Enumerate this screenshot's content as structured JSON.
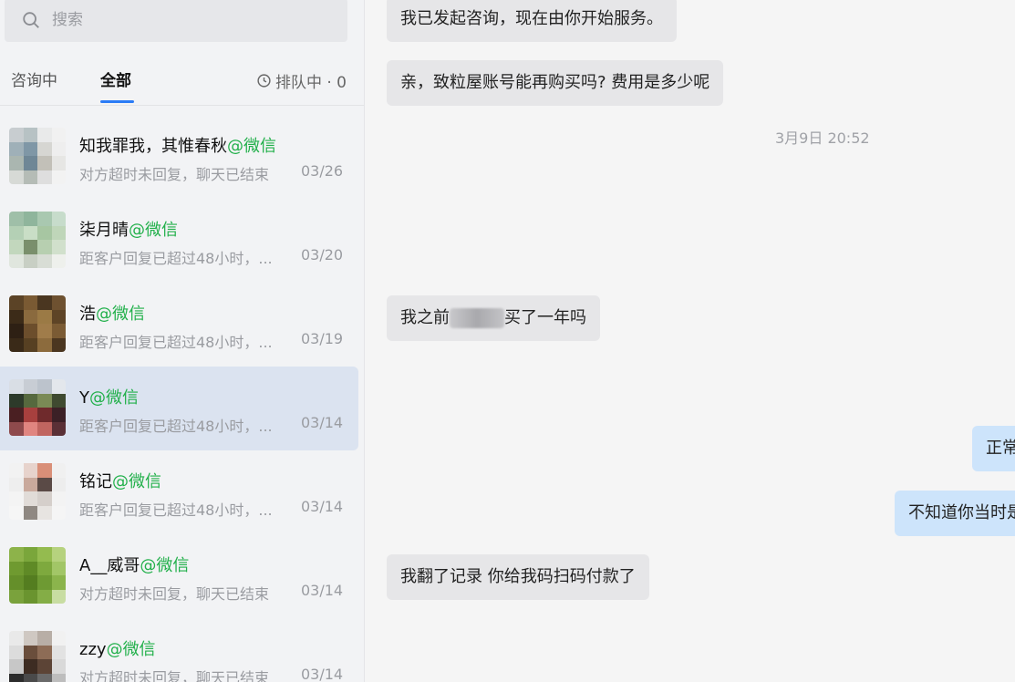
{
  "search": {
    "placeholder": "搜索"
  },
  "tabs": [
    {
      "label": "咨询中"
    },
    {
      "label": "全部"
    }
  ],
  "queue": {
    "label": "排队中 · 0"
  },
  "conversations": [
    {
      "name": "知我罪我，其惟春秋",
      "source": "@微信",
      "preview": "对方超时未回复，聊天已结束",
      "date": "03/26"
    },
    {
      "name": "柒月晴",
      "source": "@微信",
      "preview": "距客户回复已超过48小时，...",
      "date": "03/20"
    },
    {
      "name": "浩",
      "source": "@微信",
      "preview": "距客户回复已超过48小时，...",
      "date": "03/19"
    },
    {
      "name": "Y",
      "source": "@微信",
      "preview": "距客户回复已超过48小时，...",
      "date": "03/14"
    },
    {
      "name": "铭记",
      "source": "@微信",
      "preview": "距客户回复已超过48小时，...",
      "date": "03/14"
    },
    {
      "name": "A__威哥",
      "source": "@微信",
      "preview": "对方超时未回复，聊天已结束",
      "date": "03/14"
    },
    {
      "name": "zzy",
      "source": "@微信",
      "preview": "对方超时未回复，聊天已结束",
      "date": "03/14"
    }
  ],
  "messages": [
    {
      "text": "我已发起咨询，现在由你开始服务。"
    },
    {
      "text": "亲，致粒屋账号能再购买吗? 费用是多少呢"
    },
    {
      "text_before": "我之前",
      "text_after": "买了一年吗"
    },
    {
      "text": "正常"
    },
    {
      "text": "不知道你当时是"
    },
    {
      "text": "我翻了记录 你给我码扫码付款了"
    }
  ],
  "timestamp": "3月9日 20:52",
  "colors": {
    "accent": "#2b7cf6",
    "source_green": "#22b04b",
    "active_row": "#dbe3f0",
    "outgoing_bubble": "#cde4fb",
    "incoming_bubble": "#e6e6e8"
  }
}
